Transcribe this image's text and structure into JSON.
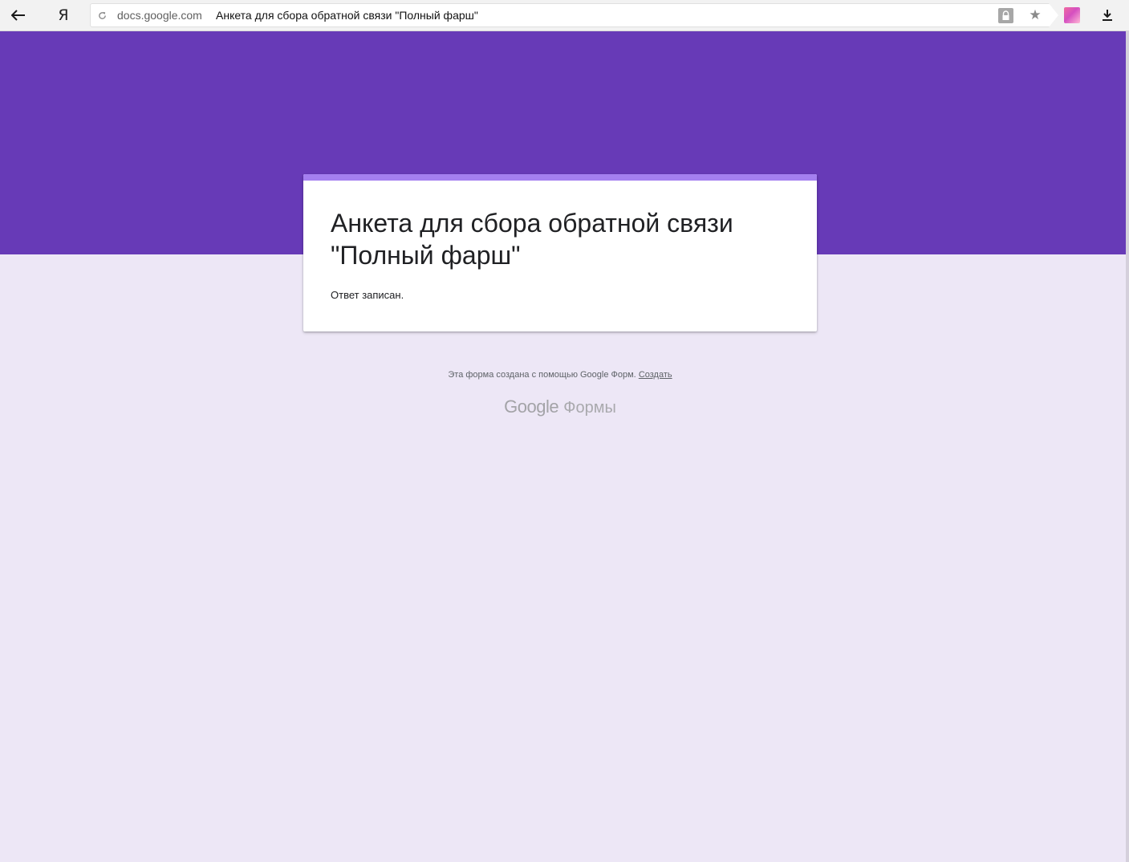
{
  "browser": {
    "yandex_label": "Я",
    "domain": "docs.google.com",
    "page_title": "Анкета для сбора обратной связи \"Полный фарш\"",
    "icons": [
      "back-arrow-icon",
      "reload-icon",
      "lock-icon",
      "star-icon",
      "extension-icon",
      "download-icon"
    ]
  },
  "form": {
    "title": "Анкета для сбора обратной связи \"Полный фарш\"",
    "confirmation": "Ответ записан.",
    "header_color": "#673ab7",
    "accent_color": "#a47ff0",
    "background_color": "#ede7f6"
  },
  "footer": {
    "text": "Эта форма создана с помощью Google Форм.",
    "link": "Создать",
    "brand_google": "Google",
    "brand_forms": "Формы"
  }
}
